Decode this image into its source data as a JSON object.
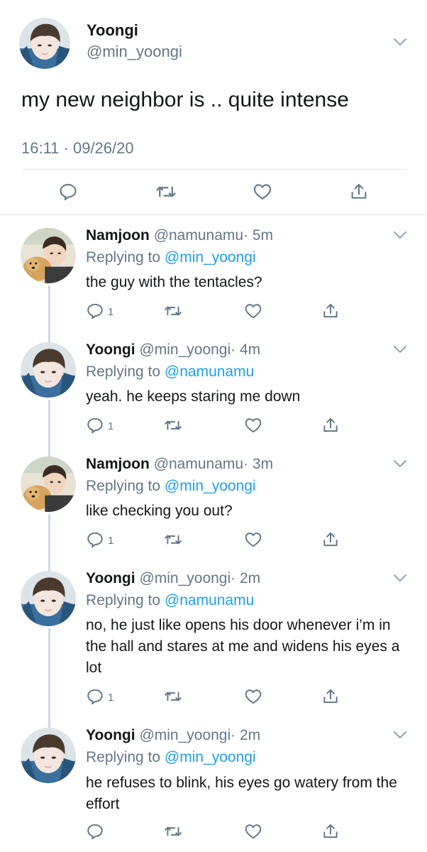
{
  "main_tweet": {
    "display_name": "Yoongi",
    "handle": "@min_yoongi",
    "text": "my new neighbor is .. quite intense",
    "timestamp": "16:11 · 09/26/20"
  },
  "icons": {
    "reply": "reply-icon",
    "retweet": "retweet-icon",
    "like": "heart-icon",
    "share": "share-icon",
    "more": "chevron-down-icon"
  },
  "colors": {
    "link": "#1da1f2",
    "muted": "#657786",
    "text": "#14171a",
    "thread_line": "#cfd9de"
  },
  "replies": [
    {
      "display_name": "Namjoon",
      "handle": "@namunamu",
      "time": "· 5m",
      "replying_label": "Replying to",
      "replying_to": "@min_yoongi",
      "text": "the guy with the tentacles?",
      "reply_count": "1"
    },
    {
      "display_name": "Yoongi",
      "handle": "@min_yoongi",
      "time": "· 4m",
      "replying_label": "Replying to",
      "replying_to": "@namunamu",
      "text": "yeah. he keeps staring me down",
      "reply_count": "1"
    },
    {
      "display_name": "Namjoon",
      "handle": "@namunamu",
      "time": "· 3m",
      "replying_label": "Replying to",
      "replying_to": "@min_yoongi",
      "text": "like checking you out?",
      "reply_count": "1"
    },
    {
      "display_name": "Yoongi",
      "handle": "@min_yoongi",
      "time": "· 2m",
      "replying_label": "Replying to",
      "replying_to": "@namunamu",
      "text": "no, he just like opens his door whenever i’m in the hall and stares at me and widens his eyes a lot",
      "reply_count": "1"
    },
    {
      "display_name": "Yoongi",
      "handle": "@min_yoongi",
      "time": "· 2m",
      "replying_label": "Replying to",
      "replying_to": "@min_yoongi",
      "text": "he refuses to blink, his eyes go watery from the effort",
      "reply_count": ""
    }
  ]
}
